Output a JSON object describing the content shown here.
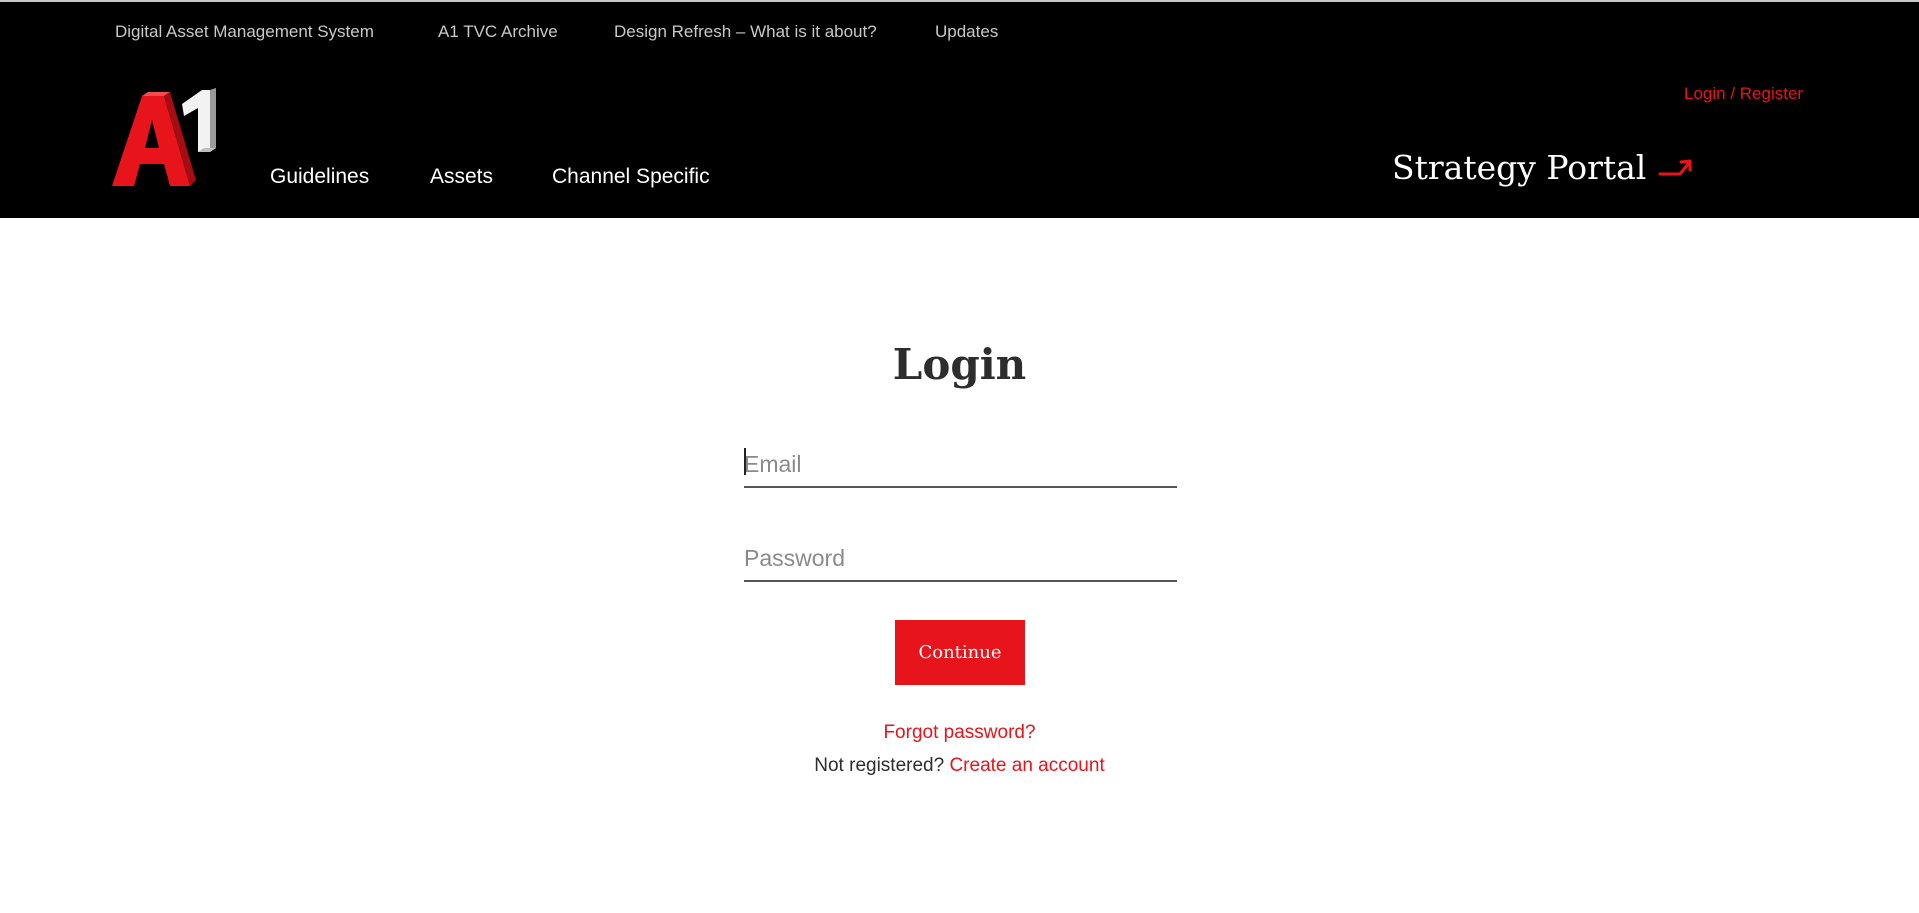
{
  "utility_nav": {
    "items": [
      {
        "label": "Digital Asset Management System"
      },
      {
        "label": "A1 TVC Archive"
      },
      {
        "label": "Design Refresh – What is it about?"
      },
      {
        "label": "Updates"
      }
    ]
  },
  "logo": {
    "alt": "A1"
  },
  "main_nav": {
    "items": [
      {
        "label": "Guidelines"
      },
      {
        "label": "Assets"
      },
      {
        "label": "Channel Specific"
      }
    ]
  },
  "account": {
    "login_register": "Login / Register"
  },
  "strategy_portal": {
    "label": "Strategy Portal",
    "icon": "arrow-up-right-icon"
  },
  "login_form": {
    "title": "Login",
    "email": {
      "placeholder": "Email",
      "value": ""
    },
    "password": {
      "placeholder": "Password",
      "value": ""
    },
    "continue_label": "Continue",
    "forgot_label": "Forgot password?",
    "not_registered": "Not registered?",
    "create_account": "Create an account"
  },
  "colors": {
    "header_bg": "#000000",
    "accent": "#e8141b",
    "text_dark": "#2d2d2d",
    "util_link": "#c9c9c9"
  }
}
